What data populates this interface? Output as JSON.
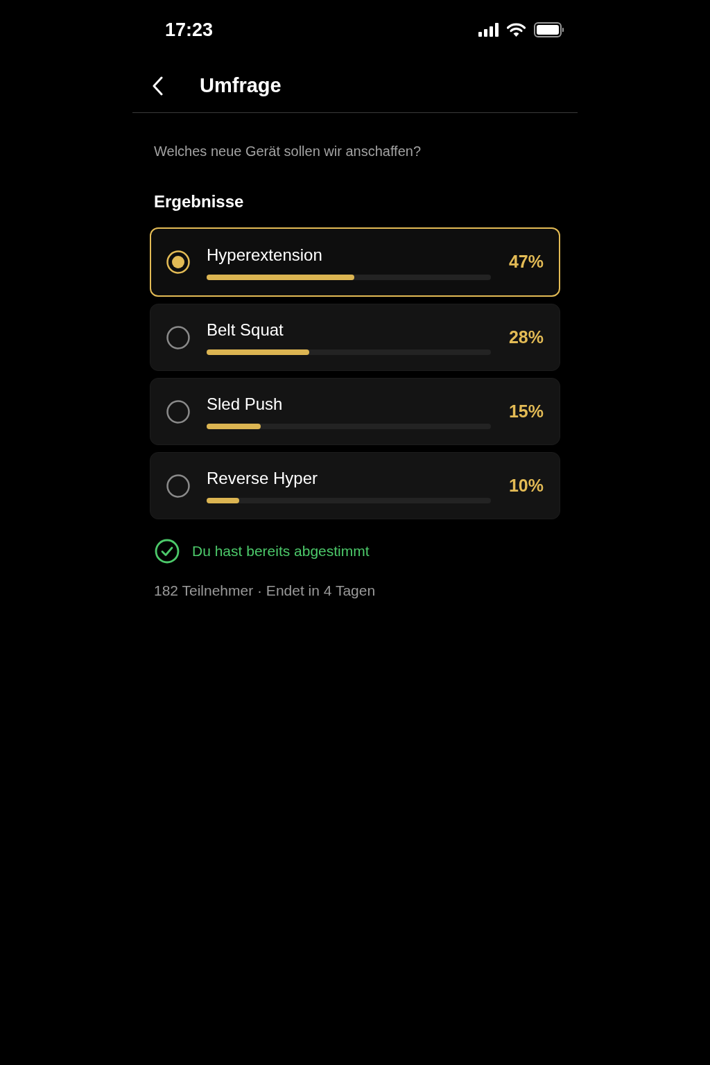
{
  "status_bar": {
    "time": "17:23"
  },
  "header": {
    "title": "Umfrage"
  },
  "question": "Welches neue Gerät sollen wir anschaffen?",
  "results": {
    "heading": "Ergebnisse",
    "options": [
      {
        "label": "Hyperextension",
        "percent": "47%",
        "level": 0.52,
        "selected": true
      },
      {
        "label": "Belt Squat",
        "percent": "28%",
        "level": 0.36,
        "selected": false
      },
      {
        "label": "Sled Push",
        "percent": "15%",
        "level": 0.19,
        "selected": false
      },
      {
        "label": "Reverse Hyper",
        "percent": "10%",
        "level": 0.115,
        "selected": false
      }
    ]
  },
  "vote_status": {
    "text": "Du hast bereits abgestimmt"
  },
  "footer": "182 Teilnehmer · Endet in 4 Tagen"
}
